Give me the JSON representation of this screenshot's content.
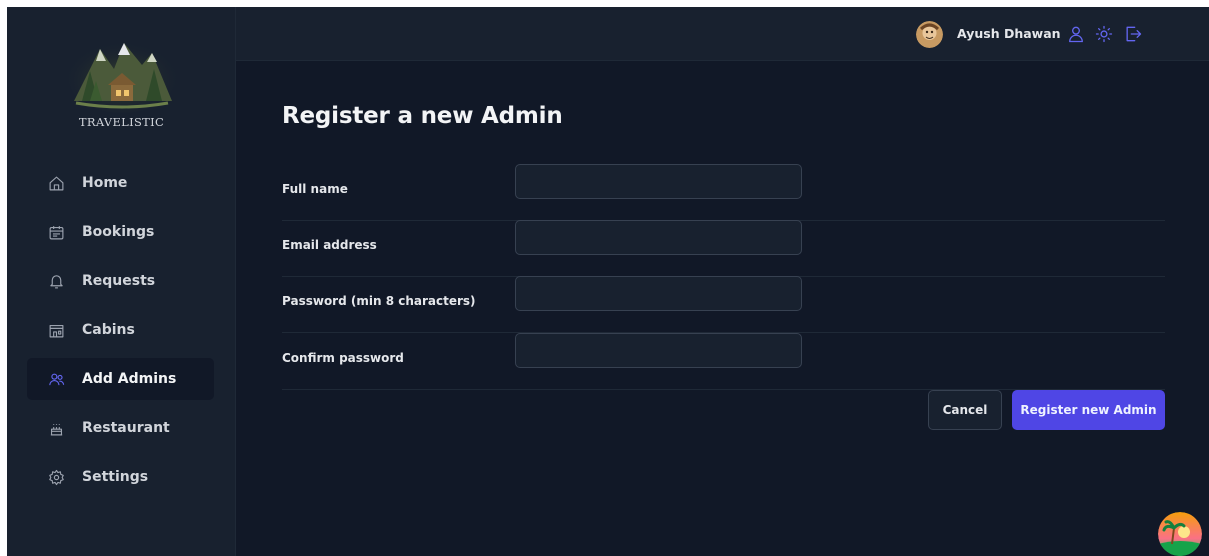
{
  "brand": {
    "name": "TRAVELISTIC"
  },
  "sidebar": {
    "items": [
      {
        "label": "Home",
        "icon": "home-icon"
      },
      {
        "label": "Bookings",
        "icon": "calendar-icon"
      },
      {
        "label": "Requests",
        "icon": "bell-icon"
      },
      {
        "label": "Cabins",
        "icon": "cabin-icon"
      },
      {
        "label": "Add Admins",
        "icon": "users-icon",
        "active": true
      },
      {
        "label": "Restaurant",
        "icon": "cake-icon"
      },
      {
        "label": "Settings",
        "icon": "gear-icon"
      }
    ]
  },
  "header": {
    "user_name": "Ayush Dhawan",
    "icons": [
      "user-icon",
      "sun-icon",
      "logout-icon"
    ]
  },
  "form": {
    "title": "Register a new Admin",
    "fields": [
      {
        "label": "Full name",
        "value": ""
      },
      {
        "label": "Email address",
        "value": ""
      },
      {
        "label": "Password (min 8 characters)",
        "value": ""
      },
      {
        "label": "Confirm password",
        "value": ""
      }
    ],
    "cancel_label": "Cancel",
    "submit_label": "Register new Admin"
  },
  "colors": {
    "background": "#111827",
    "panel": "#18212f",
    "accent": "#4f46e5",
    "icon_accent": "#6366f1"
  }
}
